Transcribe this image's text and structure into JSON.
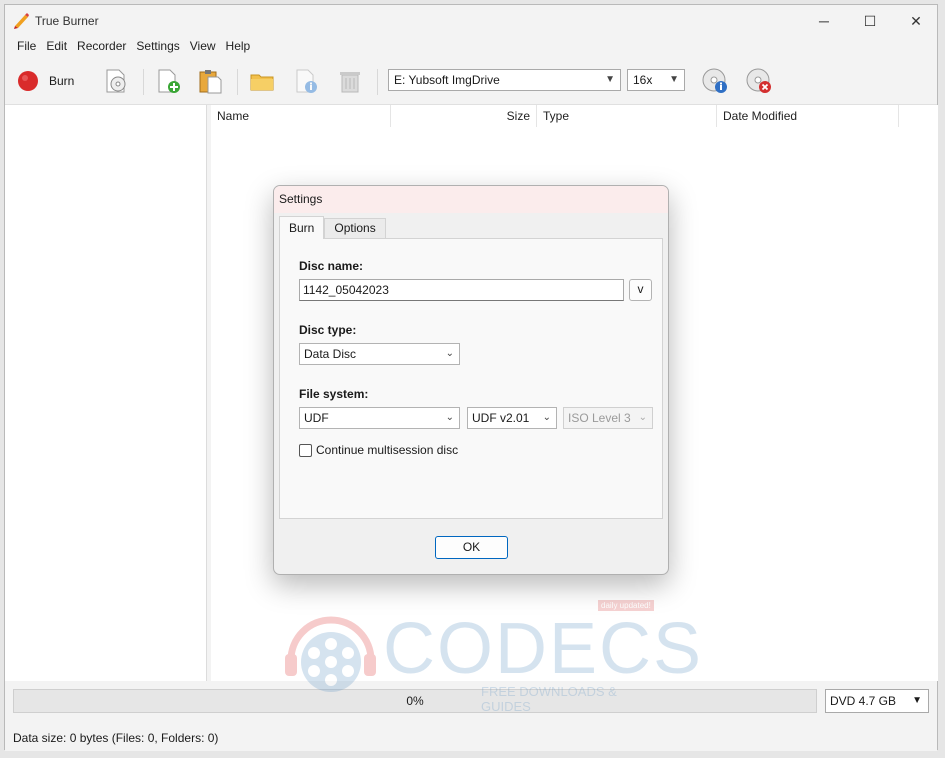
{
  "window": {
    "title": "True Burner",
    "controls": {
      "minimize": "─",
      "maximize": "☐",
      "close": "✕"
    }
  },
  "menu": [
    "File",
    "Edit",
    "Recorder",
    "Settings",
    "View",
    "Help"
  ],
  "toolbar": {
    "burn_label": "Burn",
    "recorder": "E: Yubsoft ImgDrive",
    "speed": "16x"
  },
  "columns": [
    "Name",
    "Size",
    "Type",
    "Date Modified"
  ],
  "dialog": {
    "title": "Settings",
    "tabs": [
      "Burn",
      "Options"
    ],
    "disc_name_label": "Disc name:",
    "disc_name_value": "1142_05042023",
    "disc_name_button": "v",
    "disc_type_label": "Disc type:",
    "disc_type_value": "Data Disc",
    "file_system_label": "File system:",
    "file_system_value": "UDF",
    "udf_version_value": "UDF v2.01",
    "iso_level_value": "ISO Level 3",
    "multisession_label": "Continue multisession disc",
    "multisession_checked": false,
    "ok_label": "OK"
  },
  "status": {
    "progress_text": "0%",
    "progress_value": 0,
    "disc_size": "DVD 4.7 GB",
    "data_size": "Data size: 0 bytes (Files: 0, Folders: 0)"
  },
  "watermark": {
    "brand": "CODECS",
    "tagline": "FREE DOWNLOADS & GUIDES",
    "badge": "daily updated!"
  },
  "colors": {
    "burn_red": "#d92b2b",
    "accent": "#0067c0",
    "folder_yellow": "#f2c04b"
  }
}
